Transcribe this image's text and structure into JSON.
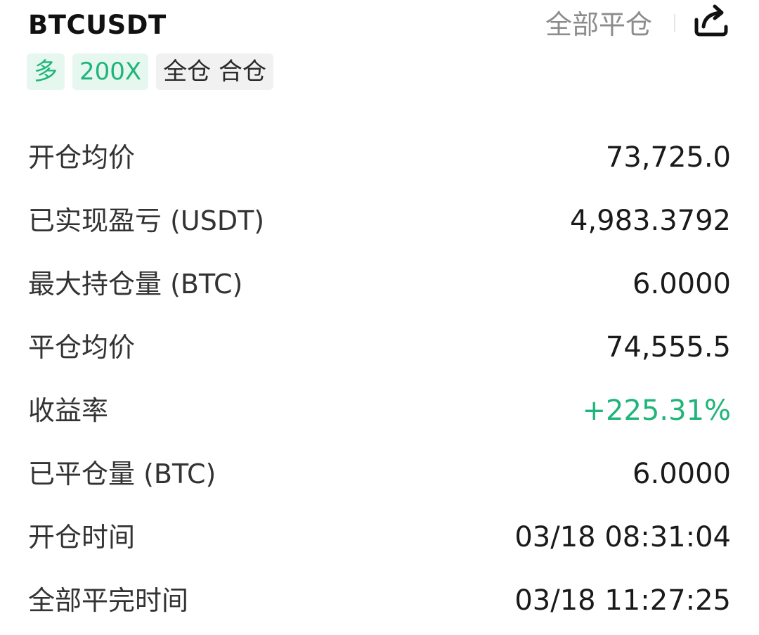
{
  "header": {
    "symbol": "BTCUSDT",
    "close_all_label": "全部平仓",
    "share_icon": "share-icon",
    "tags": [
      {
        "label": "多",
        "style": "green"
      },
      {
        "label": "200X",
        "style": "green"
      },
      {
        "label": "全仓 合仓",
        "style": "gray"
      }
    ]
  },
  "details": [
    {
      "label": "开仓均价",
      "value": "73,725.0",
      "positive": false
    },
    {
      "label": "已实现盈亏 (USDT)",
      "value": "4,983.3792",
      "positive": false
    },
    {
      "label": "最大持仓量 (BTC)",
      "value": "6.0000",
      "positive": false
    },
    {
      "label": "平仓均价",
      "value": "74,555.5",
      "positive": false
    },
    {
      "label": "收益率",
      "value": "+225.31%",
      "positive": true
    },
    {
      "label": "已平仓量 (BTC)",
      "value": "6.0000",
      "positive": false
    },
    {
      "label": "开仓时间",
      "value": "03/18 08:31:04",
      "positive": false
    },
    {
      "label": "全部平完时间",
      "value": "03/18 11:27:25",
      "positive": false
    }
  ],
  "colors": {
    "positive": "#1fb57a",
    "tag_green_bg": "#e6f7ef",
    "tag_gray_bg": "#f1f1f1",
    "muted_text": "#8c8c8c"
  }
}
